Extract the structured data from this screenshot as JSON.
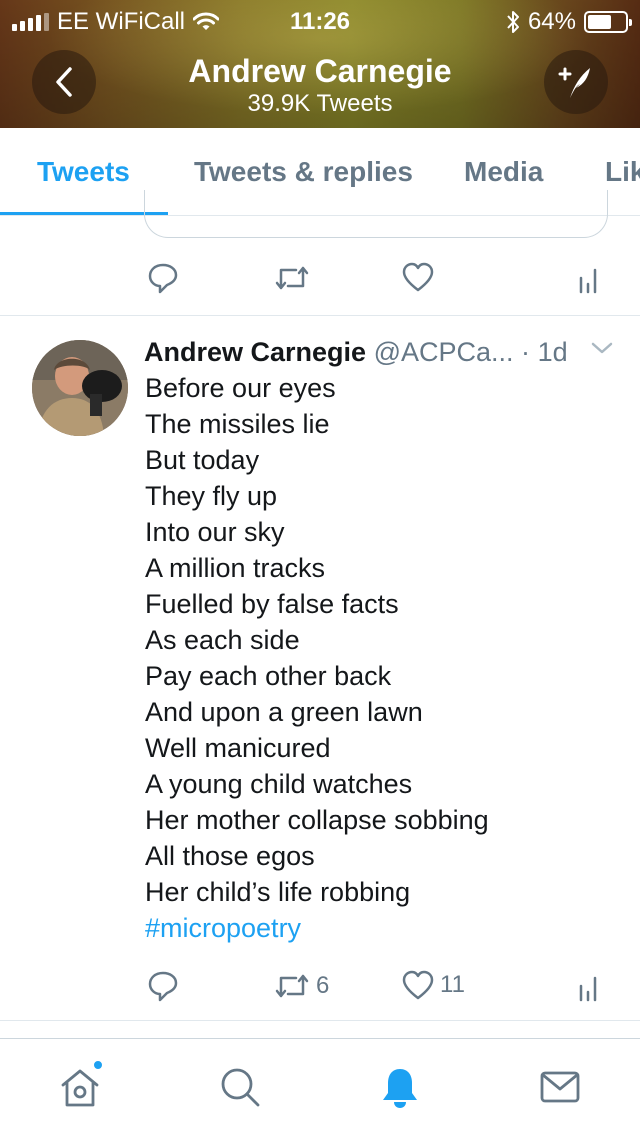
{
  "status_bar": {
    "carrier": "EE WiFiCall",
    "time": "11:26",
    "battery": "64%",
    "battery_level": 0.64
  },
  "header": {
    "name": "Andrew Carnegie",
    "tweet_count": "39.9K Tweets",
    "icons": {
      "back": "chevron-left-icon",
      "compose": "compose-feather-icon"
    }
  },
  "tabs": [
    {
      "label": "Tweets",
      "active": true
    },
    {
      "label": "Tweets & replies",
      "active": false
    },
    {
      "label": "Media",
      "active": false
    },
    {
      "label": "Lik",
      "active": false
    }
  ],
  "tweet": {
    "author_name": "Andrew Carnegie",
    "handle": "@ACPCa...",
    "separator": "·",
    "time": "1d",
    "lines": [
      "Before our eyes",
      "The missiles lie",
      "But today",
      "They fly up",
      "Into our sky",
      "A million tracks",
      "Fuelled by false facts",
      "As each side",
      "Pay each other back",
      "And upon a green lawn",
      "Well manicured",
      "A young child watches",
      "Her mother collapse sobbing",
      "All those egos",
      "Her child’s life robbing"
    ],
    "hashtag": "#micropoetry",
    "retweets": "6",
    "likes": "11"
  },
  "bottom_nav": [
    {
      "name": "home",
      "icon": "home-icon",
      "has_badge": true
    },
    {
      "name": "search",
      "icon": "search-icon"
    },
    {
      "name": "notifications",
      "icon": "bell-icon",
      "active": true
    },
    {
      "name": "messages",
      "icon": "mail-icon"
    }
  ],
  "colors": {
    "accent": "#1da1f2",
    "secondary_text": "#657786",
    "primary_text": "#14171a",
    "divider": "#e1e8ed"
  }
}
